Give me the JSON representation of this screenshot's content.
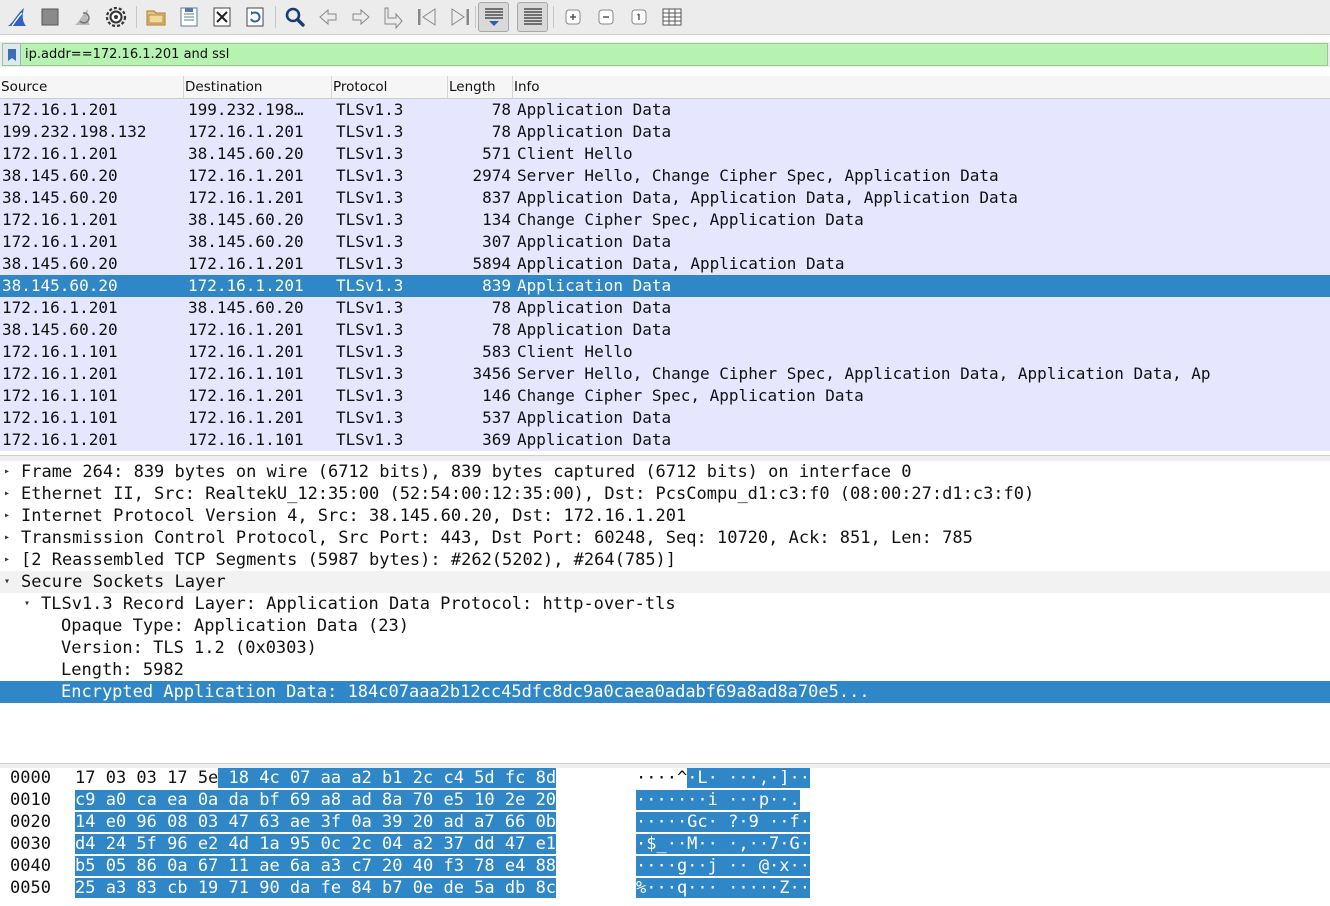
{
  "toolbar": {
    "buttons": [
      "shark-fin-start-icon",
      "stop-square-icon",
      "restart-capture-icon",
      "capture-options-gear-icon",
      "open-folder-icon",
      "save-file-icon",
      "close-file-icon",
      "reload-file-icon",
      "find-packet-icon",
      "go-back-icon",
      "go-forward-icon",
      "go-to-packet-icon",
      "first-packet-icon",
      "last-packet-icon",
      "auto-scroll-icon",
      "colorize-icon",
      "zoom-in-icon",
      "zoom-out-icon",
      "normal-size-icon",
      "resize-columns-icon"
    ]
  },
  "filter": {
    "value": "ip.addr==172.16.1.201 and ssl"
  },
  "packet_list": {
    "columns": [
      "Source",
      "Destination",
      "Protocol",
      "Length",
      "Info"
    ],
    "rows": [
      {
        "source": "172.16.1.201",
        "destination": "199.232.198…",
        "protocol": "TLSv1.3",
        "length": "78",
        "info": "Application Data"
      },
      {
        "source": "199.232.198.132",
        "destination": "172.16.1.201",
        "protocol": "TLSv1.3",
        "length": "78",
        "info": "Application Data"
      },
      {
        "source": "172.16.1.201",
        "destination": "38.145.60.20",
        "protocol": "TLSv1.3",
        "length": "571",
        "info": "Client Hello"
      },
      {
        "source": "38.145.60.20",
        "destination": "172.16.1.201",
        "protocol": "TLSv1.3",
        "length": "2974",
        "info": "Server Hello, Change Cipher Spec, Application Data"
      },
      {
        "source": "38.145.60.20",
        "destination": "172.16.1.201",
        "protocol": "TLSv1.3",
        "length": "837",
        "info": "Application Data, Application Data, Application Data"
      },
      {
        "source": "172.16.1.201",
        "destination": "38.145.60.20",
        "protocol": "TLSv1.3",
        "length": "134",
        "info": "Change Cipher Spec, Application Data"
      },
      {
        "source": "172.16.1.201",
        "destination": "38.145.60.20",
        "protocol": "TLSv1.3",
        "length": "307",
        "info": "Application Data"
      },
      {
        "source": "38.145.60.20",
        "destination": "172.16.1.201",
        "protocol": "TLSv1.3",
        "length": "5894",
        "info": "Application Data, Application Data"
      },
      {
        "source": "38.145.60.20",
        "destination": "172.16.1.201",
        "protocol": "TLSv1.3",
        "length": "839",
        "info": "Application Data",
        "selected": true
      },
      {
        "source": "172.16.1.201",
        "destination": "38.145.60.20",
        "protocol": "TLSv1.3",
        "length": "78",
        "info": "Application Data"
      },
      {
        "source": "38.145.60.20",
        "destination": "172.16.1.201",
        "protocol": "TLSv1.3",
        "length": "78",
        "info": "Application Data"
      },
      {
        "source": "172.16.1.101",
        "destination": "172.16.1.201",
        "protocol": "TLSv1.3",
        "length": "583",
        "info": "Client Hello"
      },
      {
        "source": "172.16.1.201",
        "destination": "172.16.1.101",
        "protocol": "TLSv1.3",
        "length": "3456",
        "info": "Server Hello, Change Cipher Spec, Application Data, Application Data, Ap"
      },
      {
        "source": "172.16.1.101",
        "destination": "172.16.1.201",
        "protocol": "TLSv1.3",
        "length": "146",
        "info": "Change Cipher Spec, Application Data"
      },
      {
        "source": "172.16.1.101",
        "destination": "172.16.1.201",
        "protocol": "TLSv1.3",
        "length": "537",
        "info": "Application Data"
      },
      {
        "source": "172.16.1.201",
        "destination": "172.16.1.101",
        "protocol": "TLSv1.3",
        "length": "369",
        "info": "Application Data"
      }
    ]
  },
  "details": [
    {
      "text": "Frame 264: 839 bytes on wire (6712 bits), 839 bytes captured (6712 bits) on interface 0",
      "level": 0,
      "expander": "collapsed"
    },
    {
      "text": "Ethernet II, Src: RealtekU_12:35:00 (52:54:00:12:35:00), Dst: PcsCompu_d1:c3:f0 (08:00:27:d1:c3:f0)",
      "level": 0,
      "expander": "collapsed"
    },
    {
      "text": "Internet Protocol Version 4, Src: 38.145.60.20, Dst: 172.16.1.201",
      "level": 0,
      "expander": "collapsed"
    },
    {
      "text": "Transmission Control Protocol, Src Port: 443, Dst Port: 60248, Seq: 10720, Ack: 851, Len: 785",
      "level": 0,
      "expander": "collapsed"
    },
    {
      "text": "[2 Reassembled TCP Segments (5987 bytes): #262(5202), #264(785)]",
      "level": 0,
      "expander": "collapsed"
    },
    {
      "text": "Secure Sockets Layer",
      "level": 0,
      "expander": "expanded",
      "alt": true
    },
    {
      "text": "TLSv1.3 Record Layer: Application Data Protocol: http-over-tls",
      "level": 1,
      "expander": "expanded"
    },
    {
      "text": "Opaque Type: Application Data (23)",
      "level": 2,
      "expander": "none"
    },
    {
      "text": "Version: TLS 1.2 (0x0303)",
      "level": 2,
      "expander": "none"
    },
    {
      "text": "Length: 5982",
      "level": 2,
      "expander": "none"
    },
    {
      "text": "Encrypted Application Data: 184c07aaa2b12cc45dfc8dc9a0caea0adabf69a8ad8a70e5...",
      "level": 2,
      "expander": "none",
      "selected": true
    }
  ],
  "bytes": [
    {
      "offset": "0000",
      "hex_plain": "17 03 03 17 5e",
      "hex_hl": " 18 4c 07  aa a2 b1 2c c4 5d fc 8d",
      "ascii_plain": "····^",
      "ascii_hl": "·L· ···,·]··"
    },
    {
      "offset": "0010",
      "hex_plain": "",
      "hex_hl": "c9 a0 ca ea 0a da bf 69  a8 ad 8a 70 e5 10 2e 20",
      "ascii_plain": "",
      "ascii_hl": "·······i ···p··. "
    },
    {
      "offset": "0020",
      "hex_plain": "",
      "hex_hl": "14 e0 96 08 03 47 63 ae  3f 0a 39 20 ad a7 66 0b",
      "ascii_plain": "",
      "ascii_hl": "·····Gc· ?·9 ··f·"
    },
    {
      "offset": "0030",
      "hex_plain": "",
      "hex_hl": "d4 24 5f 96 e2 4d 1a 95  0c 2c 04 a2 37 dd 47 e1",
      "ascii_plain": "",
      "ascii_hl": "·$_··M·· ·,··7·G·"
    },
    {
      "offset": "0040",
      "hex_plain": "",
      "hex_hl": "b5 05 86 0a 67 11 ae 6a  a3 c7 20 40 f3 78 e4 88",
      "ascii_plain": "",
      "ascii_hl": "····g··j ·· @·x··"
    },
    {
      "offset": "0050",
      "hex_plain": "",
      "hex_hl": "25 a3 83 cb 19 71 90 da  fe 84 b7 0e de 5a db 8c",
      "ascii_plain": "",
      "ascii_hl": "%···q··· ·····Z··"
    }
  ]
}
